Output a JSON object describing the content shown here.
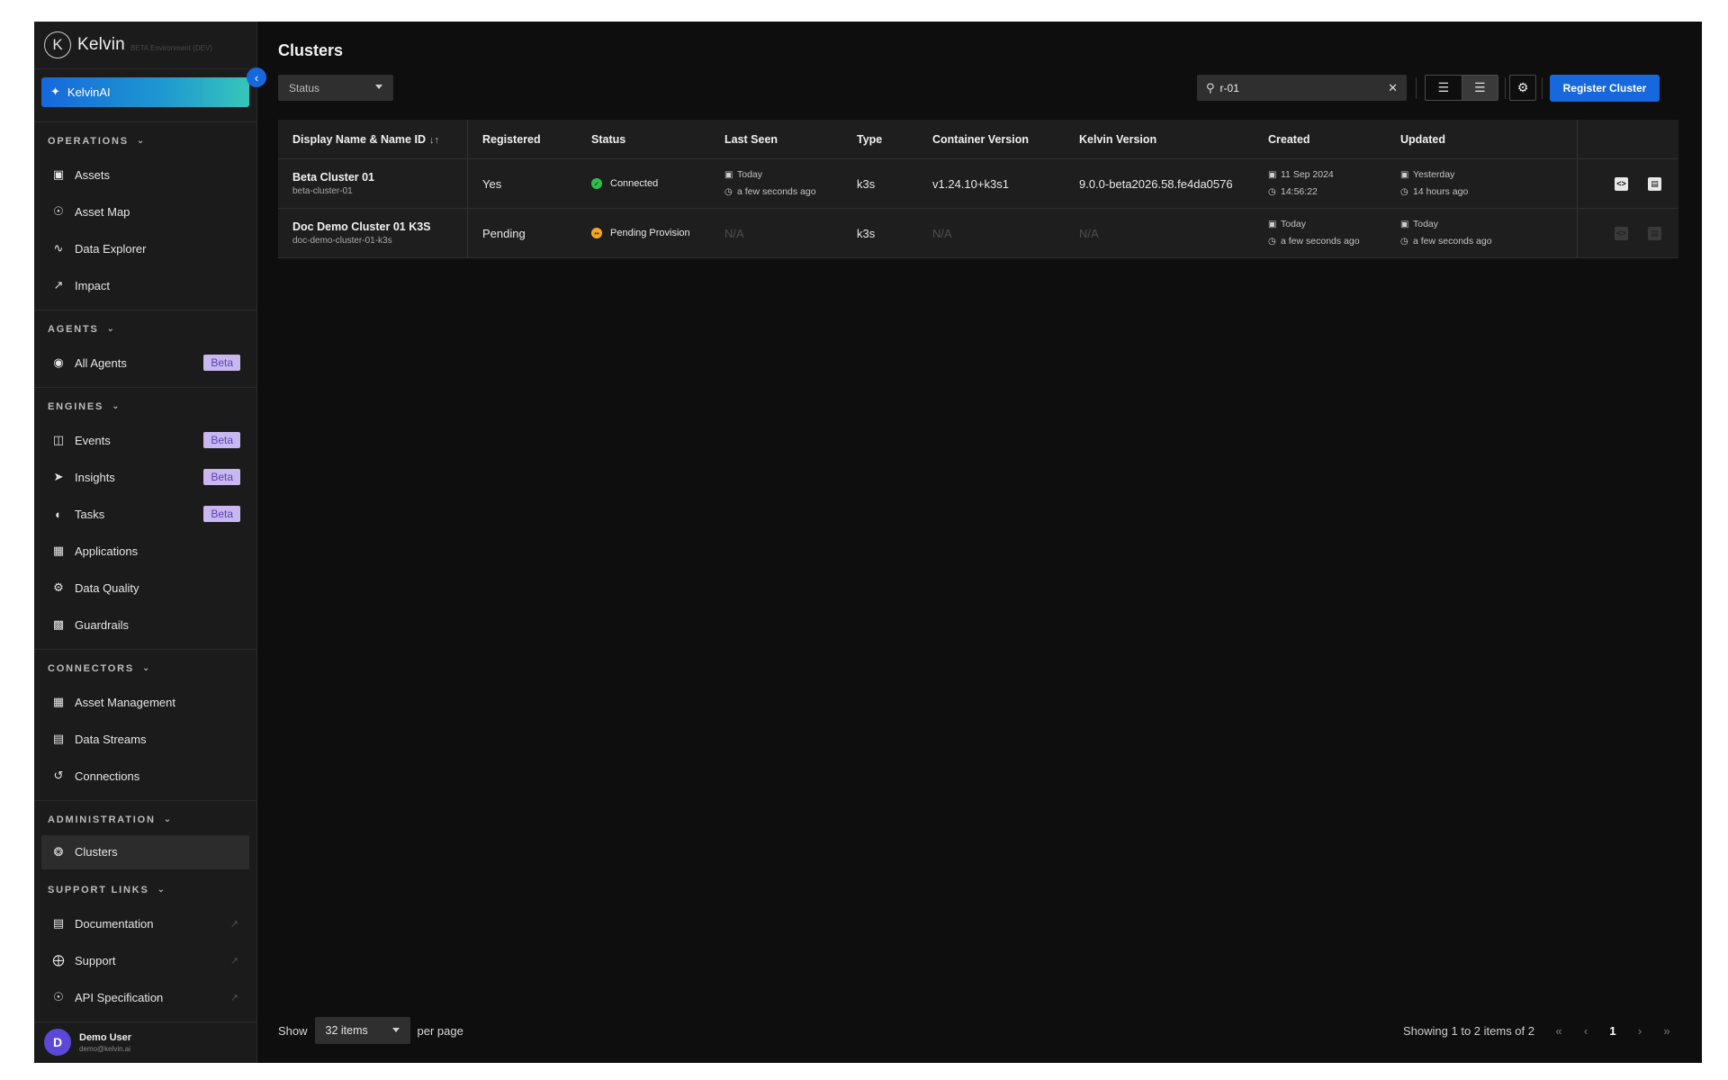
{
  "brand": {
    "name": "Kelvin",
    "env": "BETA Environment (DEV)"
  },
  "ai_button": "KelvinAI",
  "sections": [
    {
      "title": "OPERATIONS",
      "items": [
        {
          "label": "Assets",
          "icon": "assets-icon"
        },
        {
          "label": "Asset Map",
          "icon": "asset-map-icon"
        },
        {
          "label": "Data Explorer",
          "icon": "data-explorer-icon"
        },
        {
          "label": "Impact",
          "icon": "impact-icon"
        }
      ]
    },
    {
      "title": "AGENTS",
      "items": [
        {
          "label": "All Agents",
          "badge": "Beta"
        }
      ]
    },
    {
      "title": "ENGINES",
      "items": [
        {
          "label": "Events",
          "badge": "Beta"
        },
        {
          "label": "Insights",
          "badge": "Beta"
        },
        {
          "label": "Tasks",
          "badge": "Beta"
        },
        {
          "label": "Applications"
        },
        {
          "label": "Data Quality"
        },
        {
          "label": "Guardrails"
        }
      ]
    },
    {
      "title": "CONNECTORS",
      "items": [
        {
          "label": "Asset Management"
        },
        {
          "label": "Data Streams"
        },
        {
          "label": "Connections"
        }
      ]
    },
    {
      "title": "ADMINISTRATION",
      "items": [
        {
          "label": "Clusters"
        }
      ]
    },
    {
      "title": "SUPPORT LINKS",
      "items": [
        {
          "label": "Documentation"
        },
        {
          "label": "Support"
        },
        {
          "label": "API Specification"
        }
      ]
    }
  ],
  "user": {
    "initial": "D",
    "name": "Demo User",
    "email": "demo@kelvin.ai"
  },
  "page": {
    "title": "Clusters",
    "status_filter": "Status",
    "search_value": "r-01",
    "register_label": "Register Cluster"
  },
  "table": {
    "headers": {
      "name": "Display Name & Name ID",
      "registered": "Registered",
      "status": "Status",
      "last_seen": "Last Seen",
      "type": "Type",
      "container_version": "Container Version",
      "kelvin_version": "Kelvin Version",
      "created": "Created",
      "updated": "Updated"
    },
    "rows": [
      {
        "name": "Beta Cluster 01",
        "name_id": "beta-cluster-01",
        "registered": "Yes",
        "status": "Connected",
        "last_seen_date": "Today",
        "last_seen_time": "a few seconds ago",
        "type": "k3s",
        "container_version": "v1.24.10+k3s1",
        "kelvin_version": "9.0.0-beta2026.58.fe4da0576",
        "created_date": "11 Sep 2024",
        "created_time": "14:56:22",
        "updated_date": "Yesterday",
        "updated_time": "14 hours ago"
      },
      {
        "name": "Doc Demo Cluster 01 K3S",
        "name_id": "doc-demo-cluster-01-k3s",
        "registered": "Pending",
        "status": "Pending Provision",
        "last_seen": "N/A",
        "type": "k3s",
        "container_version": "N/A",
        "kelvin_version": "N/A",
        "created_date": "Today",
        "created_time": "a few seconds ago",
        "updated_date": "Today",
        "updated_time": "a few seconds ago"
      }
    ]
  },
  "footer": {
    "show": "Show",
    "per_page_value": "32 items",
    "per_page": "per page",
    "showing": "Showing 1 to 2 items of 2",
    "current_page": "1"
  },
  "colors": {
    "accent": "#1668dc",
    "connected": "#2fbf4f",
    "pending": "#f5a623",
    "beta_badge": "#c9b8ef"
  }
}
